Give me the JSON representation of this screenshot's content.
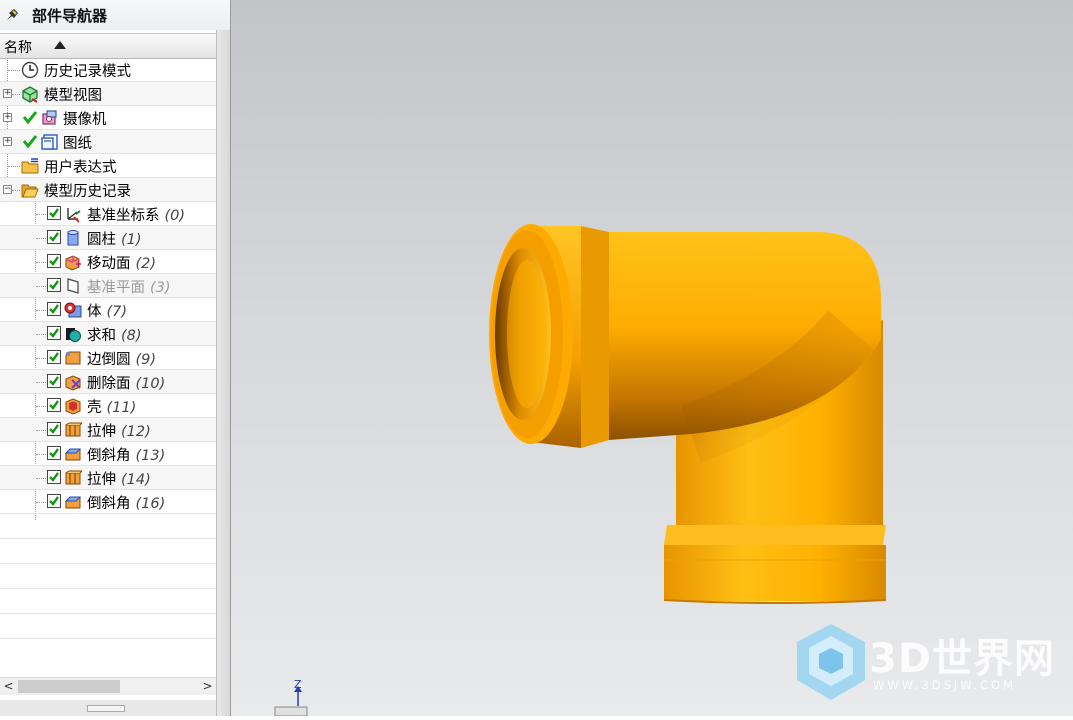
{
  "navigator": {
    "title": "部件导航器",
    "column_header": "名称",
    "top_items": [
      {
        "label": "历史记录模式",
        "icon": "clock-icon"
      },
      {
        "label": "模型视图",
        "icon": "model-view-icon"
      },
      {
        "label": "摄像机",
        "icon": "camera-icon"
      },
      {
        "label": "图纸",
        "icon": "drawing-icon"
      },
      {
        "label": "用户表达式",
        "icon": "folder-expression-icon"
      },
      {
        "label": "模型历史记录",
        "icon": "folder-open-icon"
      }
    ],
    "history_items": [
      {
        "label": "基准坐标系",
        "num": "(0)",
        "icon": "datum-csys-icon",
        "dimmed": true
      },
      {
        "label": "圆柱",
        "num": "(1)",
        "icon": "cylinder-icon",
        "dimmed": false
      },
      {
        "label": "移动面",
        "num": "(2)",
        "icon": "move-face-icon",
        "dimmed": false
      },
      {
        "label": "基准平面",
        "num": "(3)",
        "icon": "datum-plane-icon",
        "dimmed": true
      },
      {
        "label": "体",
        "num": "(7)",
        "icon": "body-icon",
        "dimmed": false
      },
      {
        "label": "求和",
        "num": "(8)",
        "icon": "unite-icon",
        "dimmed": false
      },
      {
        "label": "边倒圆",
        "num": "(9)",
        "icon": "edge-blend-icon",
        "dimmed": false
      },
      {
        "label": "删除面",
        "num": "(10)",
        "icon": "delete-face-icon",
        "dimmed": false
      },
      {
        "label": "壳",
        "num": "(11)",
        "icon": "shell-icon",
        "dimmed": false
      },
      {
        "label": "拉伸",
        "num": "(12)",
        "icon": "extrude-icon",
        "dimmed": false
      },
      {
        "label": "倒斜角",
        "num": "(13)",
        "icon": "chamfer-icon",
        "dimmed": false
      },
      {
        "label": "拉伸",
        "num": "(14)",
        "icon": "extrude-icon",
        "dimmed": false
      },
      {
        "label": "倒斜角",
        "num": "(16)",
        "icon": "chamfer-icon",
        "dimmed": false
      }
    ]
  },
  "viewport": {
    "triad_axis_label": "Z",
    "model_color": "#f5a800",
    "watermark": {
      "logo": "3D世界网",
      "url": "WWW.3DSJW.COM"
    }
  }
}
